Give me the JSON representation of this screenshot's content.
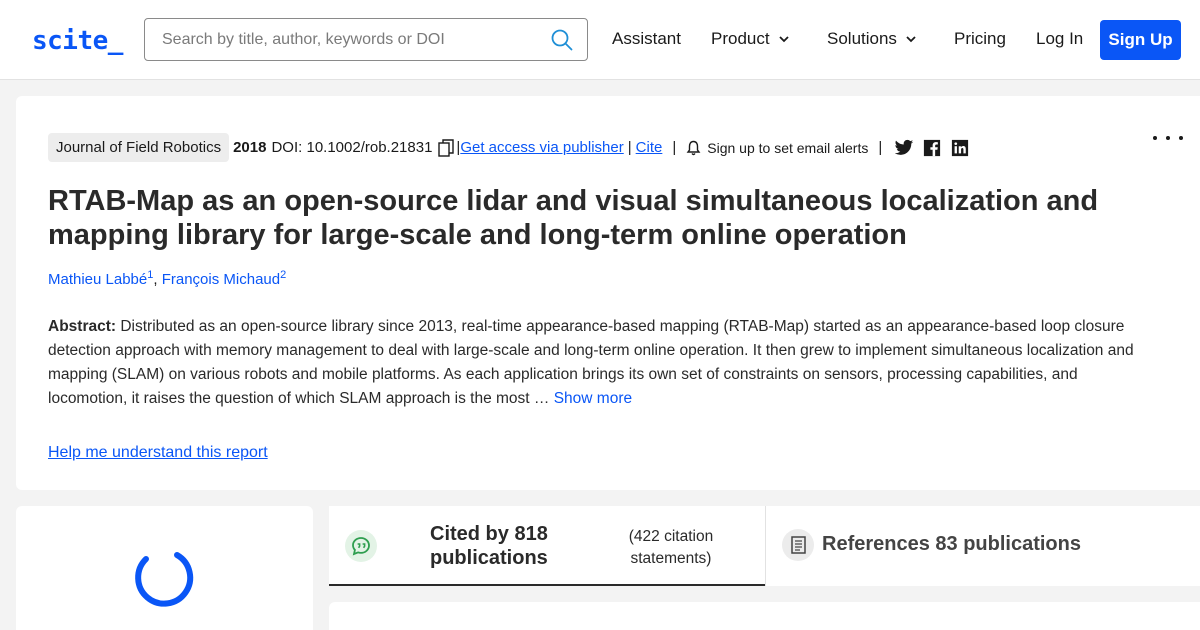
{
  "brand": {
    "logo": "scite_",
    "accent": "#0a56f6"
  },
  "search": {
    "placeholder": "Search by title, author, keywords or DOI",
    "icon": "search-icon"
  },
  "nav": {
    "assistant": "Assistant",
    "product": "Product",
    "solutions": "Solutions",
    "pricing": "Pricing",
    "login": "Log In",
    "signup": "Sign Up"
  },
  "article": {
    "journal": "Journal of Field Robotics",
    "year": "2018",
    "doi": "DOI: 10.1002/rob.21831",
    "access_link": "Get access via publisher",
    "cite_link": "Cite",
    "alert_text": "Sign up to set email alerts",
    "title": "RTAB-Map as an open-source lidar and visual simultaneous localization and mapping library for large-scale and long-term online operation",
    "authors": [
      {
        "name": "Mathieu Labbé",
        "sup": "1"
      },
      {
        "name": "François Michaud",
        "sup": "2"
      }
    ],
    "abstract_label": "Abstract:",
    "abstract_text": "Distributed as an open-source library since 2013, real-time appearance-based mapping (RTAB-Map) started as an appearance-based loop closure detection approach with memory management to deal with large-scale and long-term online operation. It then grew to implement simultaneous localization and mapping (SLAM) on various robots and mobile platforms. As each application brings its own set of constraints on sensors, processing capabilities, and locomotion, it raises the question of which SLAM approach is the most … ",
    "show_more": "Show more",
    "help_link": "Help me understand this report"
  },
  "tabs": {
    "cited_label": "Cited by 818 publications",
    "cited_sub": "(422 citation statements)",
    "refs_label": "References 83 publications"
  }
}
